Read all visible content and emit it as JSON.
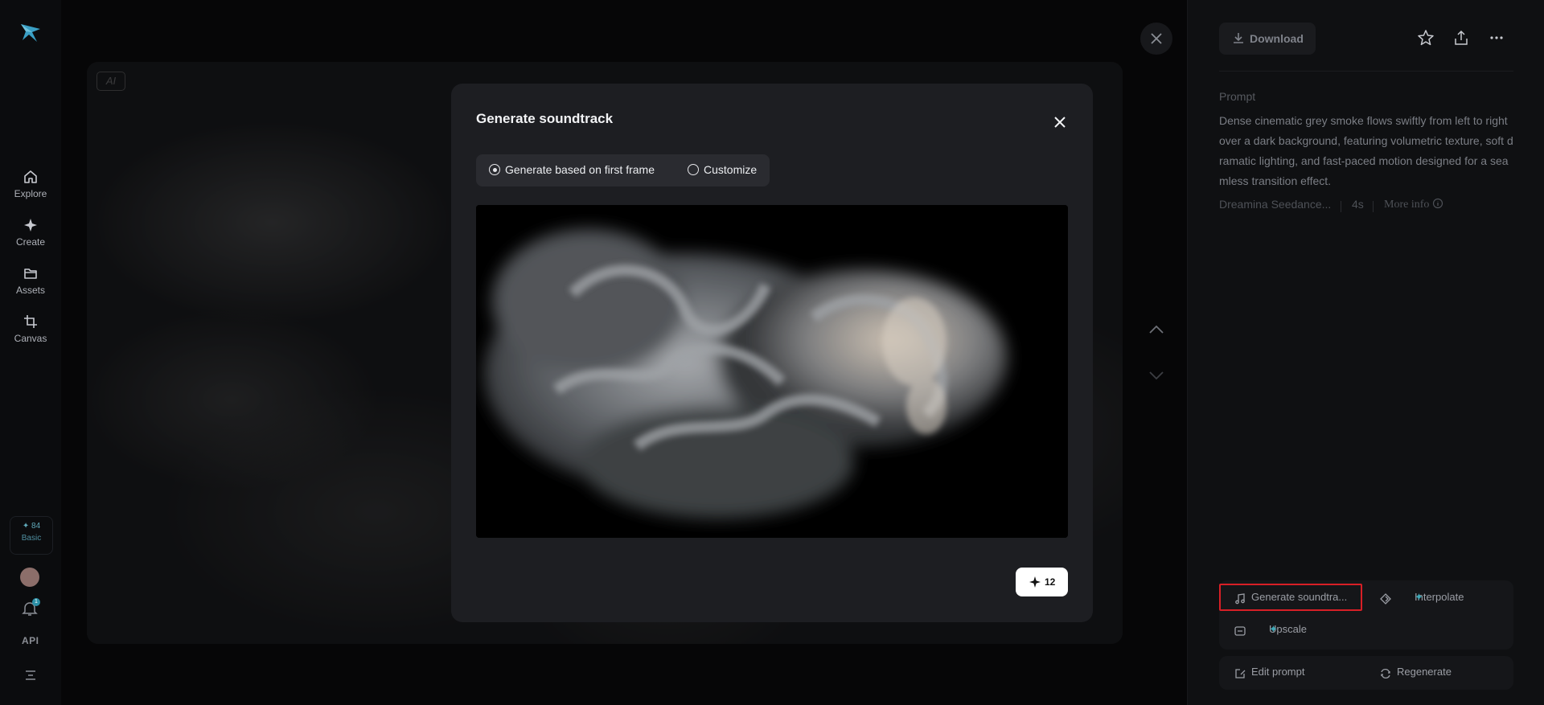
{
  "nav": {
    "items": [
      {
        "label": "Explore",
        "icon": "home-icon"
      },
      {
        "label": "Create",
        "icon": "sparkle-icon"
      },
      {
        "label": "Assets",
        "icon": "folder-icon"
      },
      {
        "label": "Canvas",
        "icon": "crop-icon"
      }
    ],
    "credits": {
      "value": "84",
      "plan": "Basic"
    },
    "notifications_count": "1",
    "api_label": "API"
  },
  "stage": {
    "ai_badge": "AI"
  },
  "modal": {
    "title": "Generate soundtrack",
    "options": [
      {
        "label": "Generate based on first frame",
        "selected": true
      },
      {
        "label": "Customize",
        "selected": false
      }
    ],
    "generate_cost": "12"
  },
  "panel": {
    "download_label": "Download",
    "prompt_label": "Prompt",
    "prompt_text": "Dense cinematic grey smoke flows swiftly from left to right over a dark background, featuring volumetric texture, soft dramatic lighting, and fast-paced motion designed for a seamless transition effect.",
    "model": "Dreamina Seedance...",
    "duration": "4s",
    "more_info": "More info",
    "actions": {
      "generate_soundtrack": "Generate soundtra...",
      "interpolate": "Interpolate",
      "upscale": "Upscale",
      "edit_prompt": "Edit prompt",
      "regenerate": "Regenerate"
    }
  },
  "colors": {
    "accent": "#3fa9b8",
    "highlight": "#d81f26",
    "modal_bg": "#1d1e22",
    "page_bg": "#0b0c0e"
  }
}
